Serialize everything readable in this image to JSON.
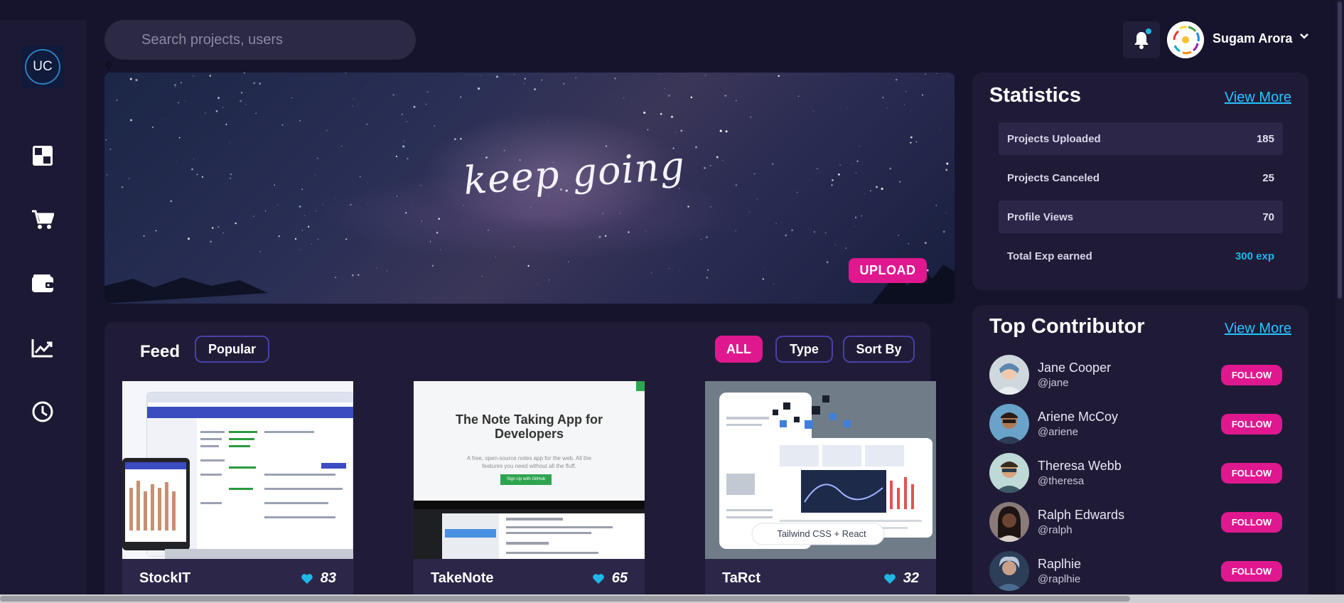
{
  "colors": {
    "background": "#16132c",
    "panel": "#1f1b37",
    "accent_pink": "#e0188f",
    "accent_cyan": "#1fb7e8",
    "link_blue": "#2bc2ff"
  },
  "sidebar": {
    "logo_text": "UC",
    "items": [
      {
        "icon": "dashboard-icon"
      },
      {
        "icon": "cart-icon"
      },
      {
        "icon": "wallet-icon"
      },
      {
        "icon": "chart-icon"
      },
      {
        "icon": "clock-icon"
      }
    ]
  },
  "header": {
    "search_placeholder": "Search projects, users",
    "user_name": "Sugam Arora"
  },
  "banner": {
    "text": "keep going",
    "upload_label": "UPLOAD"
  },
  "feed": {
    "title": "Feed",
    "sort_pill": "Popular",
    "filters": [
      "ALL",
      "Type",
      "Sort By"
    ],
    "cards": [
      {
        "title": "StockIT",
        "likes": "83"
      },
      {
        "title": "TakeNote",
        "likes": "65",
        "hero_title": "The Note Taking App for Developers",
        "hero_sub": "A free, open-source notes app for the web. All the features you need without all the fluff.",
        "hero_button": "Sign Up with GitHub"
      },
      {
        "title": "TaRct",
        "likes": "32",
        "badge": "Tailwind CSS + React"
      }
    ]
  },
  "statistics": {
    "title": "Statistics",
    "view_more": "View More",
    "rows": [
      {
        "label": "Projects Uploaded",
        "value": "185"
      },
      {
        "label": "Projects Canceled",
        "value": "25"
      },
      {
        "label": "Profile Views",
        "value": "70"
      },
      {
        "label": "Total Exp earned",
        "value": "300 exp"
      }
    ]
  },
  "contributors": {
    "title": "Top Contributor",
    "view_more": "View More",
    "follow_label": "FOLLOW",
    "people": [
      {
        "name": "Jane Cooper",
        "handle": "@jane"
      },
      {
        "name": "Ariene McCoy",
        "handle": "@ariene"
      },
      {
        "name": "Theresa Webb",
        "handle": "@theresa"
      },
      {
        "name": "Ralph Edwards",
        "handle": "@ralph"
      },
      {
        "name": "Raplhie",
        "handle": "@raplhie"
      }
    ]
  }
}
